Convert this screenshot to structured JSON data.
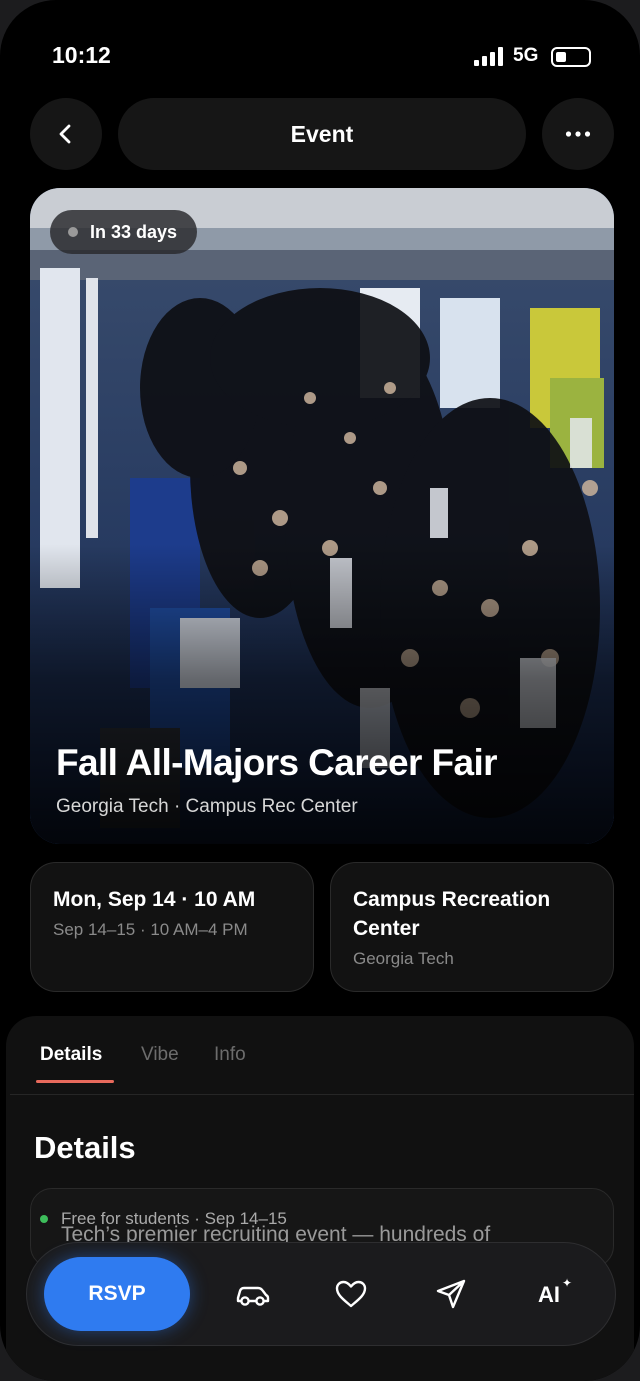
{
  "status_bar": {
    "time": "10:12",
    "network": "5G"
  },
  "header": {
    "title": "Event"
  },
  "hero": {
    "countdown": "In 33 days",
    "title": "Fall All-Majors Career Fair",
    "subtitle": "Georgia Tech · Campus Rec Center"
  },
  "when_card": {
    "main": "Mon, Sep 14 · 10 AM",
    "sub": "Sep 14–15 · 10 AM–4 PM"
  },
  "where_card": {
    "main_line1": "Campus Recreation",
    "main_line2": "Center",
    "sub": "Georgia Tech"
  },
  "tabs": [
    {
      "label": "Details",
      "active": true
    },
    {
      "label": "Vibe",
      "active": false
    },
    {
      "label": "Info",
      "active": false
    }
  ],
  "details": {
    "heading": "Details",
    "meta": "Free for students · Sep 14–15",
    "description": "Tech’s premier recruiting event — hundreds of"
  },
  "action_bar": {
    "rsvp_label": "RSVP",
    "ai_label": "AI"
  },
  "colors": {
    "accent_blue": "#2f7bf0",
    "tab_underline": "#e86a5c",
    "status_dot": "#3dbd5b"
  },
  "icons": [
    "back-icon",
    "more-icon",
    "car-icon",
    "heart-icon",
    "send-icon",
    "sparkle-icon"
  ]
}
